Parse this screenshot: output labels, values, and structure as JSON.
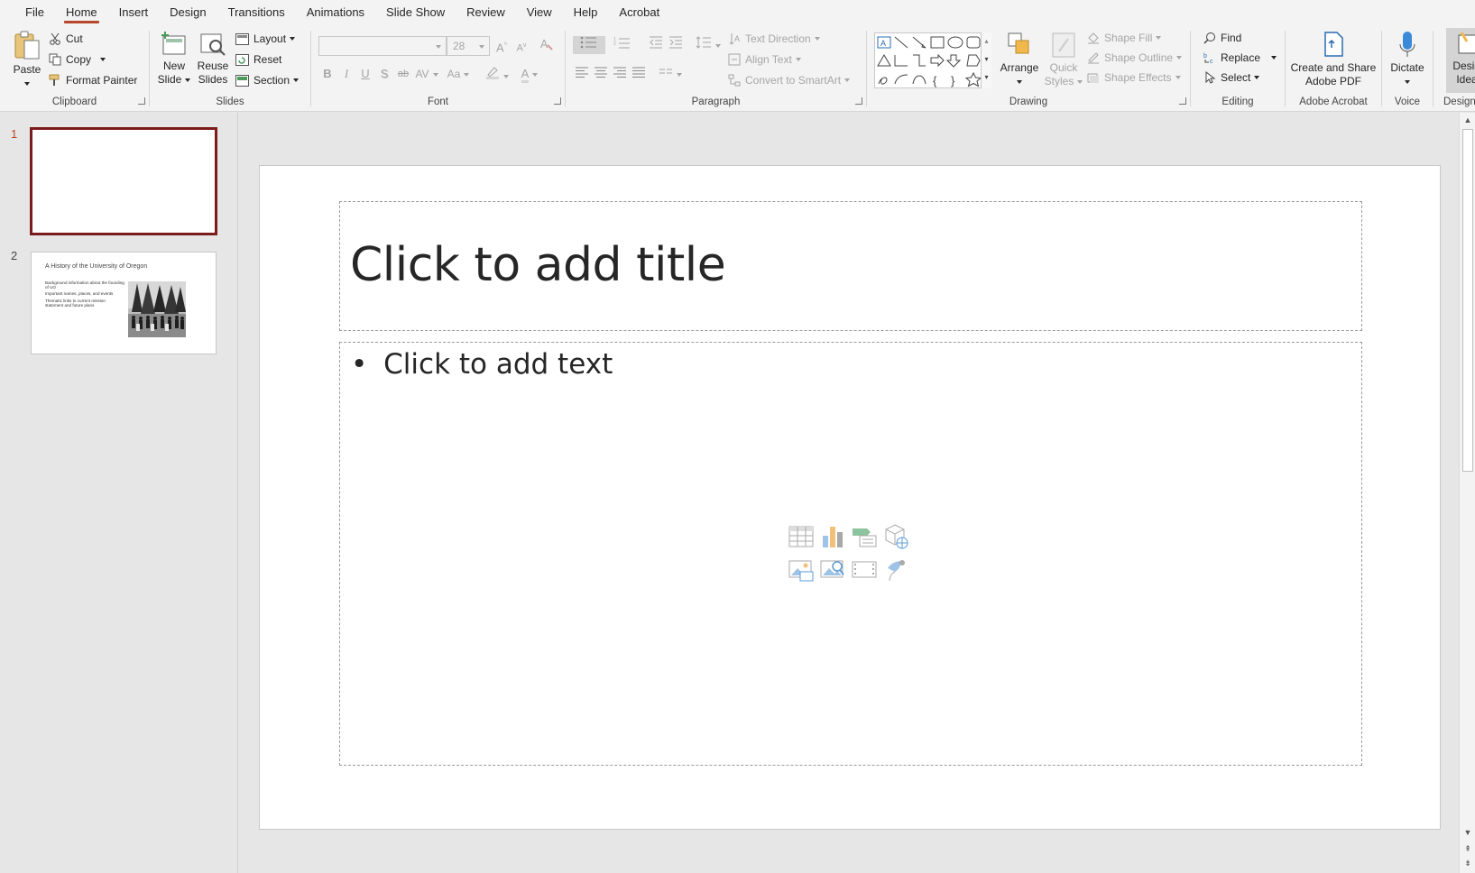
{
  "menu": {
    "tabs": [
      "File",
      "Home",
      "Insert",
      "Design",
      "Transitions",
      "Animations",
      "Slide Show",
      "Review",
      "View",
      "Help",
      "Acrobat"
    ],
    "active": "Home"
  },
  "ribbon": {
    "clipboard": {
      "label": "Clipboard",
      "paste": "Paste",
      "cut": "Cut",
      "copy": "Copy",
      "format_painter": "Format Painter"
    },
    "slides": {
      "label": "Slides",
      "new_slide_1": "New",
      "new_slide_2": "Slide",
      "reuse_1": "Reuse",
      "reuse_2": "Slides",
      "layout": "Layout",
      "reset": "Reset",
      "section": "Section"
    },
    "font": {
      "label": "Font",
      "font_name": "",
      "font_size": "28",
      "bold": "B",
      "italic": "I",
      "underline": "U",
      "shadow": "S",
      "strike": "ab",
      "spacing": "AV",
      "case": "Aa",
      "color": "A"
    },
    "paragraph": {
      "label": "Paragraph",
      "text_direction": "Text Direction",
      "align_text": "Align Text",
      "convert_smartart": "Convert to SmartArt"
    },
    "drawing": {
      "label": "Drawing",
      "arrange": "Arrange",
      "quick_styles_1": "Quick",
      "quick_styles_2": "Styles",
      "shape_fill": "Shape Fill",
      "shape_outline": "Shape Outline",
      "shape_effects": "Shape Effects"
    },
    "editing": {
      "label": "Editing",
      "find": "Find",
      "replace": "Replace",
      "select": "Select"
    },
    "acrobat": {
      "label": "Adobe Acrobat",
      "create_1": "Create and Share",
      "create_2": "Adobe PDF"
    },
    "voice": {
      "label": "Voice",
      "dictate": "Dictate"
    },
    "designer": {
      "label": "Designer",
      "ideas_1": "Design",
      "ideas_2": "Ideas"
    }
  },
  "thumbnails": [
    {
      "number": "1",
      "selected": true
    },
    {
      "number": "2",
      "selected": false,
      "title": "A History of the University of Oregon",
      "bullets": [
        "Background information about the founding of UO",
        "Important names, places, and events",
        "Thematic links to current mission statement and future plans"
      ]
    }
  ],
  "slide": {
    "title_placeholder": "Click to add title",
    "body_placeholder": "Click to add text",
    "bullet": "•"
  },
  "colors": {
    "accent": "#b7472a",
    "selection": "#7b1c1c"
  }
}
